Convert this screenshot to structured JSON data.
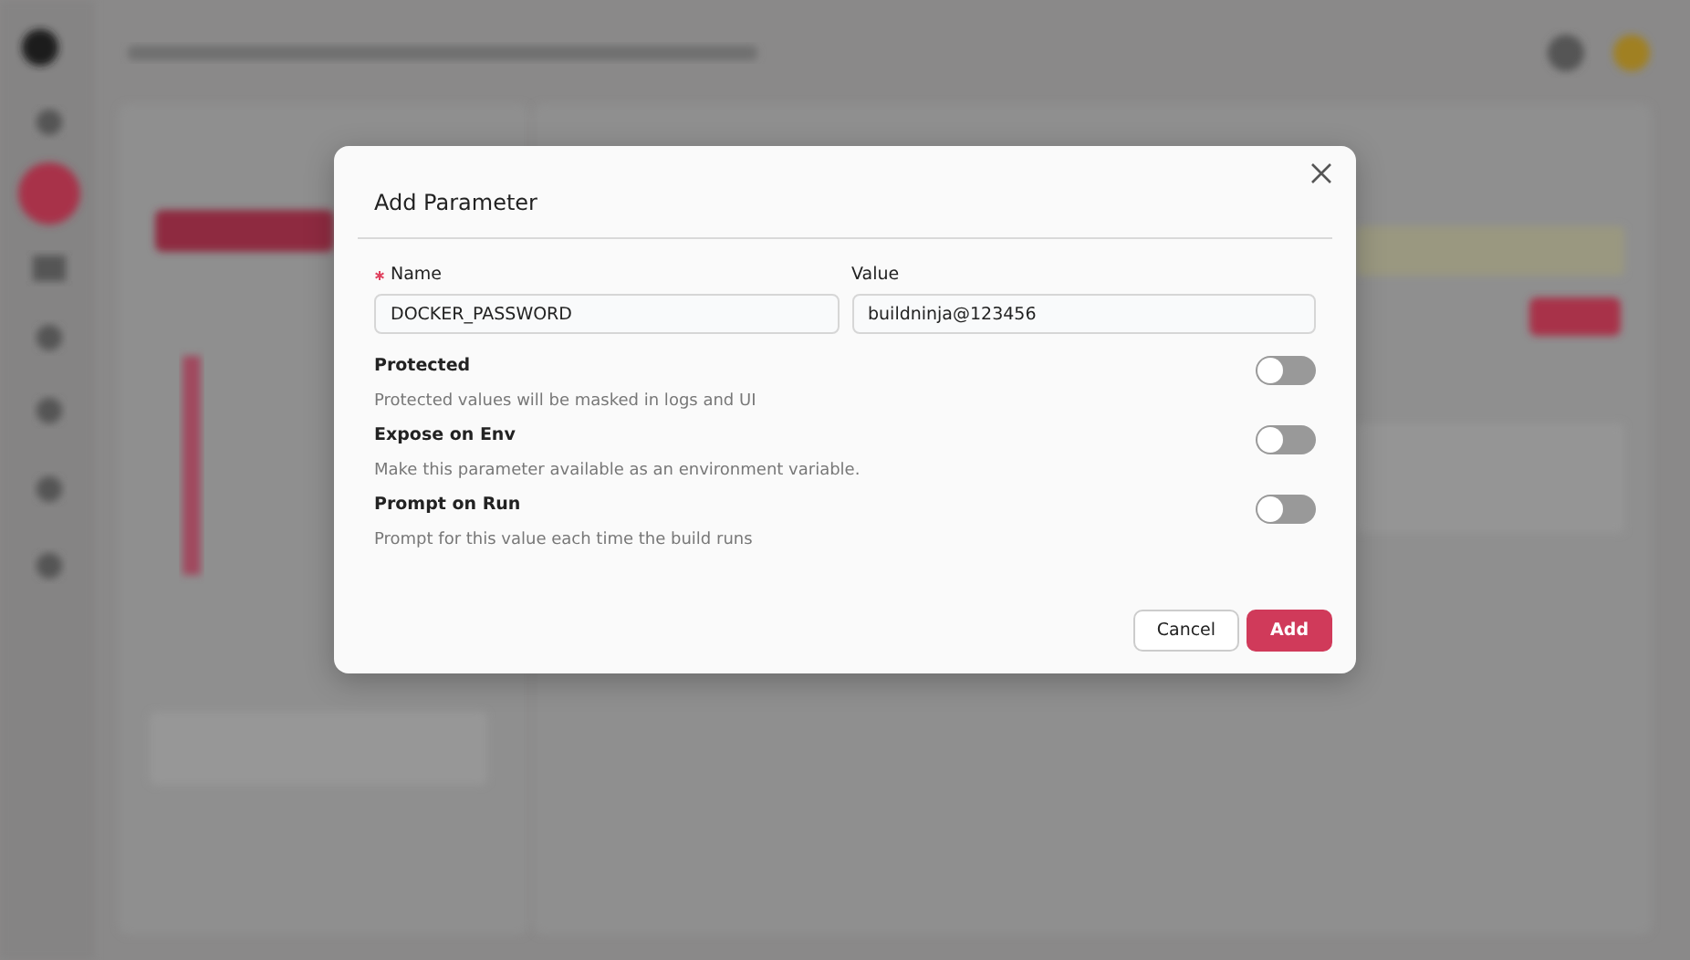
{
  "dialog": {
    "title": "Add Parameter",
    "fields": [
      {
        "label": "Name",
        "required": true,
        "value": "DOCKER_PASSWORD"
      },
      {
        "label": "Value",
        "required": false,
        "value": "buildninja@123456"
      }
    ],
    "options": [
      {
        "title": "Protected",
        "description": "Protected values will be masked in logs and UI",
        "on": false
      },
      {
        "title": "Expose on Env",
        "description": "Make this parameter available as an environment variable.",
        "on": false
      },
      {
        "title": "Prompt on Run",
        "description": "Prompt for this value each time the build runs",
        "on": false
      }
    ],
    "buttons": [
      {
        "label": "Cancel",
        "kind": "secondary"
      },
      {
        "label": "Add",
        "kind": "primary"
      }
    ]
  }
}
